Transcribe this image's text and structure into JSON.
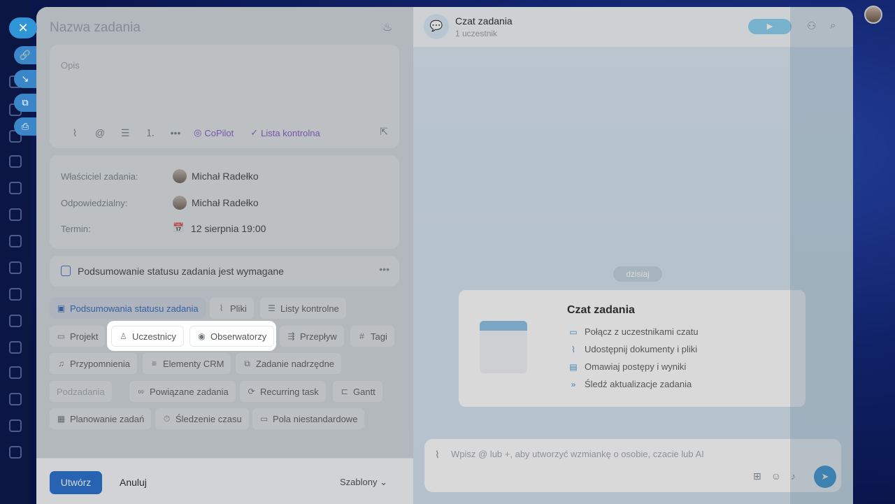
{
  "task_panel": {
    "title": "Nazwa zadania",
    "description_placeholder": "Opis",
    "toolbar": {
      "copilot_label": "CoPilot",
      "checklist_label": "Lista kontrolna"
    },
    "meta": {
      "owner_label": "Właściciel zadania:",
      "owner_value": "Michał Radełko",
      "responsible_label": "Odpowiedzialny:",
      "responsible_value": "Michał Radełko",
      "deadline_label": "Termin:",
      "deadline_value": "12 sierpnia 19:00"
    },
    "summary_required": "Podsumowanie statusu zadania jest wymagane",
    "chips": {
      "status_summaries": "Podsumowania statusu zadania",
      "files": "Pliki",
      "checklists": "Listy kontrolne",
      "project": "Projekt",
      "participants": "Uczestnicy",
      "observers": "Obserwatorzy",
      "flow": "Przepływ",
      "tags": "Tagi",
      "reminders": "Przypomnienia",
      "crm": "Elementy CRM",
      "parent_task": "Zadanie nadrzędne",
      "subtasks": "Podzadania",
      "related": "Powiązane zadania",
      "recurring": "Recurring task",
      "gantt": "Gantt",
      "planning": "Planowanie zadań",
      "time_tracking": "Śledzenie czasu",
      "custom_fields": "Pola niestandardowe"
    },
    "footer": {
      "create_label": "Utwórz",
      "cancel_label": "Anuluj",
      "templates_label": "Szablony"
    }
  },
  "chat_panel": {
    "title": "Czat zadania",
    "subtitle": "1 uczestnik",
    "date_pill": "dzisiaj",
    "welcome": {
      "title": "Czat zadania",
      "items": [
        "Połącz z uczestnikami czatu",
        "Udostępnij dokumenty i pliki",
        "Omawiaj postępy i wyniki",
        "Śledź aktualizacje zadania"
      ]
    },
    "input_placeholder": "Wpisz @ lub +, aby utworzyć wzmiankę o osobie, czacie lub AI"
  },
  "colors": {
    "accent": "#2e75d0",
    "copilot": "#8a4fd8",
    "chat_send": "#2f95d6"
  }
}
